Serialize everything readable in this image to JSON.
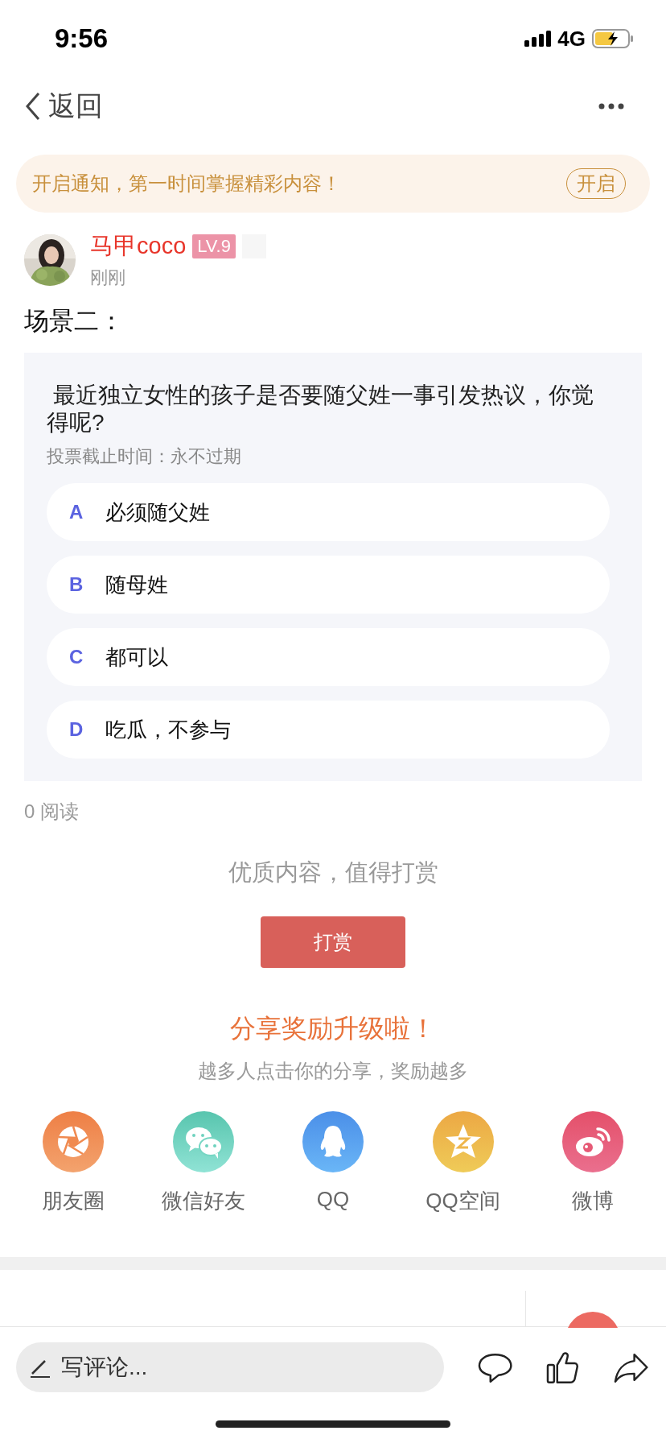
{
  "status_bar": {
    "time": "9:56",
    "network": "4G"
  },
  "nav": {
    "back": "返回"
  },
  "notice": {
    "text": "开启通知，第一时间掌握精彩内容！",
    "button": "开启"
  },
  "post": {
    "author": "马甲coco",
    "level": "LV.9",
    "time": "刚刚",
    "title": "场景二：",
    "poll": {
      "question": " 最近独立女性的孩子是否要随父姓一事引发热议，你觉得呢?",
      "deadline": "投票截止时间：永不过期",
      "options": [
        {
          "letter": "A",
          "text": "必须随父姓"
        },
        {
          "letter": "B",
          "text": "随母姓"
        },
        {
          "letter": "C",
          "text": "都可以"
        },
        {
          "letter": "D",
          "text": "吃瓜，不参与"
        }
      ]
    },
    "reads": "0 阅读"
  },
  "reward": {
    "prompt": "优质内容，值得打赏",
    "button": "打赏"
  },
  "share": {
    "title": "分享奖励升级啦！",
    "subtitle": "越多人点击你的分享，奖励越多",
    "targets": [
      {
        "kind": "moments",
        "label": "朋友圈"
      },
      {
        "kind": "wechat",
        "label": "微信好友"
      },
      {
        "kind": "qq",
        "label": "QQ"
      },
      {
        "kind": "qzone",
        "label": "QQ空间"
      },
      {
        "kind": "weibo",
        "label": "微博"
      }
    ]
  },
  "comment_bar": {
    "placeholder": "写评论..."
  }
}
